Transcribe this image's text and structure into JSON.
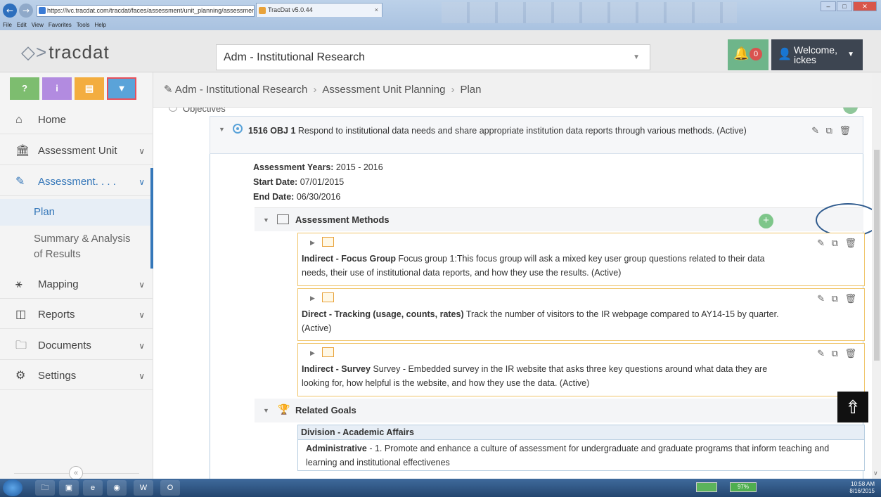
{
  "browser": {
    "url": "https://lvc.tracdat.com/tracdat/faces/assessment/unit_planning/assessmentPlan.",
    "tab_title": "TracDat v5.0.44",
    "menu": [
      "File",
      "Edit",
      "View",
      "Favorites",
      "Tools",
      "Help"
    ]
  },
  "header": {
    "logo_text": "tracdat",
    "unit_select_value": "Adm - Institutional Research",
    "notification_count": "0",
    "welcome_line1": "Welcome,",
    "welcome_line2": "ickes"
  },
  "toolbar_buttons": [
    {
      "name": "help-button",
      "label": "?",
      "color": "#7dbd6f"
    },
    {
      "name": "info-button",
      "label": "i",
      "color": "#b28be0"
    },
    {
      "name": "notes-button",
      "label": "▤",
      "color": "#f3ad3f"
    },
    {
      "name": "filter-button",
      "label": "▼",
      "color": "#5aa3d9"
    }
  ],
  "sidebar": {
    "items": [
      {
        "label": "Home",
        "icon": "home-icon"
      },
      {
        "label": "Assessment Unit",
        "icon": "bank-icon"
      },
      {
        "label": "Assessment. . . .",
        "icon": "pencil-icon"
      },
      {
        "label": "Mapping",
        "icon": "sitemap-icon"
      },
      {
        "label": "Reports",
        "icon": "columns-icon"
      },
      {
        "label": "Documents",
        "icon": "folder-icon"
      },
      {
        "label": "Settings",
        "icon": "gear-icon"
      }
    ],
    "sub_items": [
      "Plan",
      "Summary & Analysis of Results"
    ],
    "collapse": "«"
  },
  "breadcrumb": [
    "Adm - Institutional Research",
    "Assessment Unit Planning",
    "Plan"
  ],
  "objectives_label": "Objectives",
  "objective": {
    "code": "1516 OBJ 1",
    "text": "Respond to institutional data needs and share appropriate institution data reports through various methods. (Active)",
    "years_label": "Assessment Years:",
    "years": "2015 - 2016",
    "start_label": "Start Date:",
    "start": "07/01/2015",
    "end_label": "End Date:",
    "end": "06/30/2016"
  },
  "assessment_methods": {
    "label": "Assessment Methods",
    "add": "+",
    "items": [
      {
        "type": "Indirect - Focus Group",
        "text": "Focus group 1:This focus group will ask a mixed key user group questions related to their data needs, their use of institutional data reports, and how they use the results. (Active)"
      },
      {
        "type": "Direct - Tracking (usage, counts, rates)",
        "text": "Track the number of visitors to the IR webpage compared to AY14-15 by quarter. (Active)"
      },
      {
        "type": "Indirect - Survey",
        "text": "Survey - Embedded survey in the IR website that asks three key questions around what data they are looking for, how helpful is the website, and how they use the data. (Active)"
      }
    ]
  },
  "related_goals": {
    "label": "Related Goals",
    "division": "Division - Academic Affairs",
    "goal_type": "Administrative",
    "goal_text": "- 1. Promote and enhance a culture of assessment for undergraduate and graduate programs that inform teaching and learning and institutional effectivenes"
  },
  "actions": "✎ ⧉ 🗑",
  "taskbar": {
    "battery": "97%",
    "time": "10:58 AM",
    "date": "8/16/2015"
  }
}
